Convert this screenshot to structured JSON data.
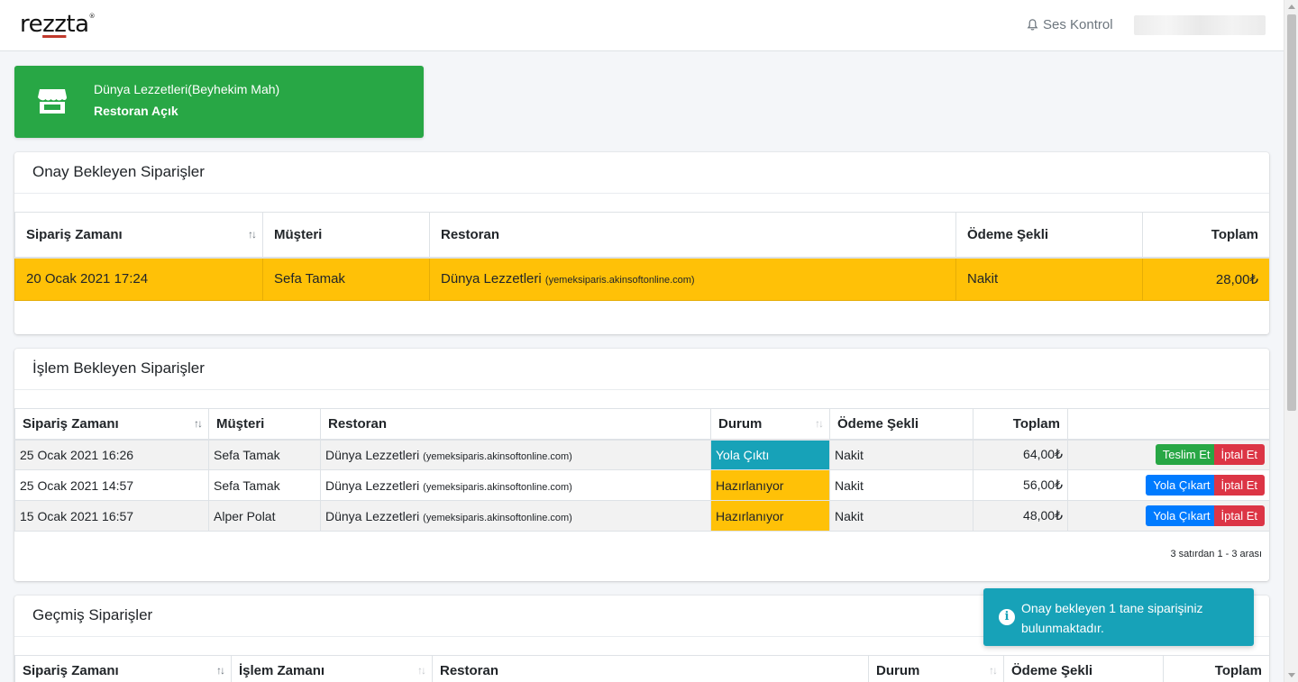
{
  "header": {
    "logo": {
      "prefix": "re",
      "zz": "zz",
      "suffix": "ta",
      "mark": "®"
    },
    "sound_control": "Ses Kontrol",
    "sound_icon": "bell-icon"
  },
  "restaurant_status": {
    "icon": "store-icon",
    "name": "Dünya Lezzetleri(Beyhekim Mah)",
    "state": "Restoran Açık",
    "color": "#28a745"
  },
  "pending_approval": {
    "title": "Onay Bekleyen Siparişler",
    "columns": [
      "Sipariş Zamanı",
      "Müşteri",
      "Restoran",
      "Ödeme Şekli",
      "Toplam"
    ],
    "rows": [
      {
        "time": "20 Ocak 2021 17:24",
        "customer": "Sefa Tamak",
        "restaurant": "Dünya Lezzetleri",
        "site": "(yemeksiparis.akinsoftonline.com)",
        "payment": "Nakit",
        "total": "28,00₺"
      }
    ],
    "row_color": "#ffc107"
  },
  "pending_processing": {
    "title": "İşlem Bekleyen Siparişler",
    "columns": [
      "Sipariş Zamanı",
      "Müşteri",
      "Restoran",
      "Durum",
      "Ödeme Şekli",
      "Toplam"
    ],
    "rows": [
      {
        "time": "25 Ocak 2021 16:26",
        "customer": "Sefa Tamak",
        "restaurant": "Dünya Lezzetleri",
        "site": "(yemeksiparis.akinsoftonline.com)",
        "status": "Yola Çıktı",
        "payment": "Nakit",
        "total": "64,00₺",
        "primary_action": "Teslim Et",
        "cancel_action": "İptal Et"
      },
      {
        "time": "25 Ocak 2021 14:57",
        "customer": "Sefa Tamak",
        "restaurant": "Dünya Lezzetleri",
        "site": "(yemeksiparis.akinsoftonline.com)",
        "status": "Hazırlanıyor",
        "payment": "Nakit",
        "total": "56,00₺",
        "primary_action": "Yola Çıkart",
        "cancel_action": "İptal Et"
      },
      {
        "time": "15 Ocak 2021 16:57",
        "customer": "Alper Polat",
        "restaurant": "Dünya Lezzetleri",
        "site": "(yemeksiparis.akinsoftonline.com)",
        "status": "Hazırlanıyor",
        "payment": "Nakit",
        "total": "48,00₺",
        "primary_action": "Yola Çıkart",
        "cancel_action": "İptal Et"
      }
    ],
    "info": "3 satırdan 1 - 3 arası",
    "status_colors": {
      "Yola Çıktı": "#17a2b8",
      "Hazırlanıyor": "#ffc107"
    }
  },
  "past_orders": {
    "title": "Geçmiş Siparişler",
    "columns": [
      "Sipariş Zamanı",
      "İşlem Zamanı",
      "Restoran",
      "Durum",
      "Ödeme Şekli",
      "Toplam"
    ]
  },
  "toast": {
    "icon": "info-icon",
    "message": "Onay bekleyen 1 tane siparişiniz bulunmaktadır.",
    "color": "#17a2b8"
  }
}
